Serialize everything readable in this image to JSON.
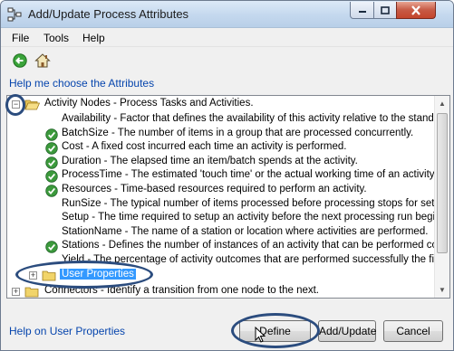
{
  "window": {
    "title": "Add/Update Process Attributes",
    "controls": {
      "minimize": "minimize",
      "maximize": "maximize",
      "close": "close"
    }
  },
  "menu": [
    "File",
    "Tools",
    "Help"
  ],
  "toolbar": {
    "back_icon": "back-arrow-icon",
    "home_icon": "home-icon"
  },
  "help_link": "Help me choose the Attributes",
  "tree": {
    "root": {
      "label": "Activity Nodes - Process Tasks and Activities.",
      "expanded": true,
      "expander": "−",
      "children": [
        {
          "label": "Availability - Factor that defines the availability of this activity relative to the standard av",
          "checked": false
        },
        {
          "label": "BatchSize - The number of items in a group that are processed concurrently.",
          "checked": true
        },
        {
          "label": "Cost - A fixed cost incurred each time an activity is performed.",
          "checked": true
        },
        {
          "label": "Duration - The elapsed time an item/batch spends at the activity.",
          "checked": true
        },
        {
          "label": "ProcessTime - The estimated 'touch time' or the actual working time of an activity.",
          "checked": true
        },
        {
          "label": "Resources - Time-based resources required to perform an activity.",
          "checked": true
        },
        {
          "label": "RunSize - The typical number of items processed before processing stops for setup or c",
          "checked": false
        },
        {
          "label": "Setup - The time required to setup an activity before the next processing run begins.",
          "checked": false
        },
        {
          "label": "StationName - The name of a station or location where activities are performed.",
          "checked": false
        },
        {
          "label": "Stations - Defines the number of instances of an activity that can be performed concurr",
          "checked": true
        },
        {
          "label": "Yield - The percentage of activity outcomes that are performed successfully the first tim",
          "checked": false
        }
      ],
      "sub_folder": {
        "label": "User Properties",
        "expander": "+",
        "selected": true
      }
    },
    "second_root": {
      "label": "Connectors - Identify a transition from one node to the next.",
      "expander": "+"
    }
  },
  "footer": {
    "help_link": "Help on User Properties",
    "buttons": {
      "define": "Define",
      "add_update": "Add/Update",
      "cancel": "Cancel"
    }
  },
  "colors": {
    "selection": "#3399ff",
    "link": "#0645ad",
    "check": "#3c9a3c",
    "annotation": "#2b4c7e"
  }
}
